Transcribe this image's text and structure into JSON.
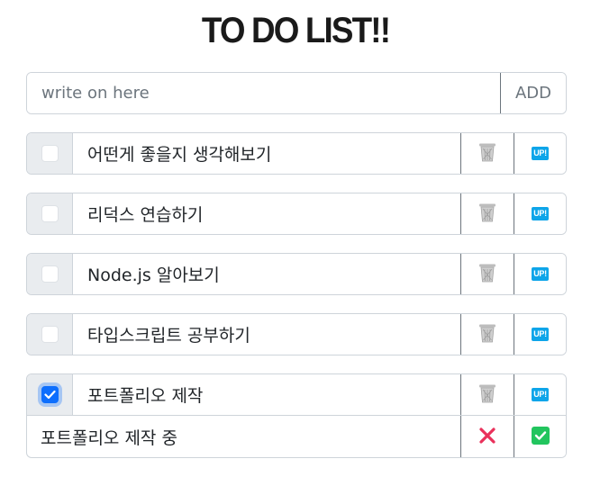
{
  "header": {
    "title": "TO DO LIST!!"
  },
  "input": {
    "placeholder": "write on here",
    "value": "",
    "add_label": "ADD"
  },
  "todos": [
    {
      "text": "어떤게 좋을지 생각해보기",
      "checked": false,
      "up_label": "UP!"
    },
    {
      "text": "리덕스 연습하기",
      "checked": false,
      "up_label": "UP!"
    },
    {
      "text": "Node.js 알아보기",
      "checked": false,
      "up_label": "UP!"
    },
    {
      "text": "타입스크립트 공부하기",
      "checked": false,
      "up_label": "UP!"
    },
    {
      "text": "포트폴리오 제작",
      "checked": true,
      "up_label": "UP!"
    }
  ],
  "edit": {
    "value": "포트폴리오 제작 중",
    "cancel_icon": "close-icon",
    "confirm_icon": "check-icon"
  },
  "icons": {
    "delete": "trash-icon",
    "move_up": "up-icon"
  },
  "colors": {
    "accent": "#0d6efd",
    "cancel": "#e9305a",
    "confirm": "#22c55e",
    "up_badge": "#0ea5e9"
  }
}
